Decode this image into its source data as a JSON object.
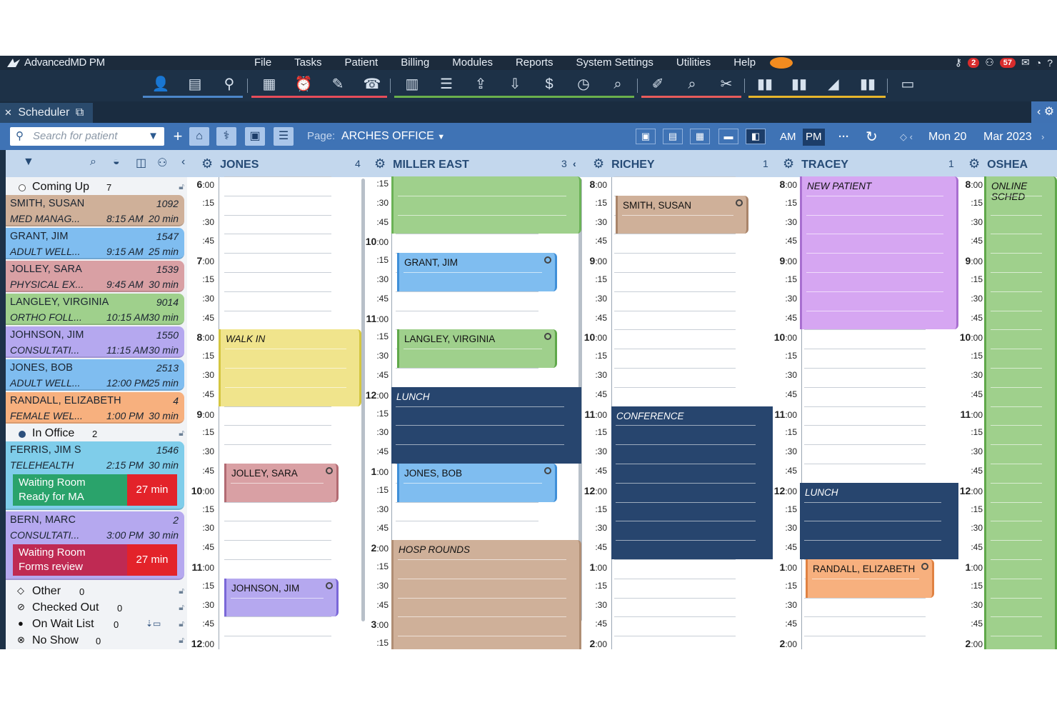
{
  "app": {
    "title": "AdvancedMD PM"
  },
  "menu": [
    "File",
    "Tasks",
    "Patient",
    "Billing",
    "Modules",
    "Reports",
    "System Settings",
    "Utilities",
    "Help"
  ],
  "badges": {
    "alerts": "2",
    "messages": "57"
  },
  "tab": {
    "label": "Scheduler"
  },
  "toolbar": {
    "search_placeholder": "Search for patient",
    "page_label": "Page:",
    "page_value": "ARCHES OFFICE",
    "am": "AM",
    "pm": "PM",
    "more": "···",
    "date_day": "Mon 20",
    "date_month": "Mar 2023"
  },
  "left_panel": {
    "coming_up": {
      "label": "Coming Up",
      "count": "7"
    },
    "in_office": {
      "label": "In Office",
      "count": "2"
    },
    "other": {
      "label": "Other",
      "count": "0"
    },
    "checked_out": {
      "label": "Checked Out",
      "count": "0"
    },
    "wait_list": {
      "label": "On Wait List",
      "count": "0"
    },
    "no_show": {
      "label": "No Show",
      "count": "0"
    },
    "coming_up_cards": [
      {
        "name": "SMITH, SUSAN",
        "id": "1092",
        "type": "MED MANAG...",
        "time": "8:15 AM",
        "dur": "20 min",
        "color": "#cfb099"
      },
      {
        "name": "GRANT, JIM",
        "id": "1547",
        "type": "ADULT WELL...",
        "time": "9:15 AM",
        "dur": "25 min",
        "color": "#7fbdf0"
      },
      {
        "name": "JOLLEY, SARA",
        "id": "1539",
        "type": "PHYSICAL EX...",
        "time": "9:45 AM",
        "dur": "30 min",
        "color": "#d9a0a4"
      },
      {
        "name": "LANGLEY, VIRGINIA",
        "id": "9014",
        "type": "ORTHO FOLL...",
        "time": "10:15 AM",
        "dur": "30 min",
        "color": "#9fd08c"
      },
      {
        "name": "JOHNSON, JIM",
        "id": "1550",
        "type": "CONSULTATI...",
        "time": "11:15 AM",
        "dur": "30 min",
        "color": "#b5a8ef"
      },
      {
        "name": "JONES, BOB",
        "id": "2513",
        "type": "ADULT WELL...",
        "time": "12:00 PM",
        "dur": "25 min",
        "color": "#7fbdf0"
      },
      {
        "name": "RANDALL, ELIZABETH",
        "id": "4",
        "type": "FEMALE WEL...",
        "time": "1:00 PM",
        "dur": "30 min",
        "color": "#f7b07e"
      }
    ],
    "in_office_cards": [
      {
        "name": "FERRIS, JIM S",
        "id": "1546",
        "type": "TELEHEALTH",
        "time": "2:15 PM",
        "dur": "30 min",
        "color": "#7fcdea",
        "room": "Waiting Room",
        "status": "Ready for MA",
        "wait": "27 min",
        "room_color": "#2aa36b"
      },
      {
        "name": "BERN, MARC",
        "id": "2",
        "type": "CONSULTATI...",
        "time": "3:00 PM",
        "dur": "30 min",
        "color": "#b5a8ef",
        "room": "Waiting Room",
        "status": "Forms review",
        "wait": "27 min",
        "room_color": "#bf2a53"
      }
    ]
  },
  "columns": [
    {
      "name": "JONES",
      "count": "4"
    },
    {
      "name": "MILLER EAST",
      "count": "3"
    },
    {
      "name": "RICHEY",
      "count": "1"
    },
    {
      "name": "TRACEY",
      "count": "1"
    },
    {
      "name": "OSHEA",
      "count": ""
    }
  ],
  "appointments": {
    "walk_in": "WALK IN",
    "jolley": "JOLLEY, SARA",
    "johnson": "JOHNSON, JIM",
    "grant": "GRANT, JIM",
    "langley": "LANGLEY, VIRGINIA",
    "lunch_miller": "LUNCH",
    "jones_bob": "JONES, BOB",
    "hosp_rounds": "HOSP ROUNDS",
    "smith": "SMITH, SUSAN",
    "conference": "CONFERENCE",
    "new_patient": "NEW PATIENT",
    "lunch_tracey": "LUNCH",
    "randall": "RANDALL, ELIZABETH",
    "online": "ONLINE SCHED"
  },
  "colors": {
    "header_bg": "#1d3147",
    "accent": "#3f73b5",
    "block_dark": "#27456e"
  }
}
